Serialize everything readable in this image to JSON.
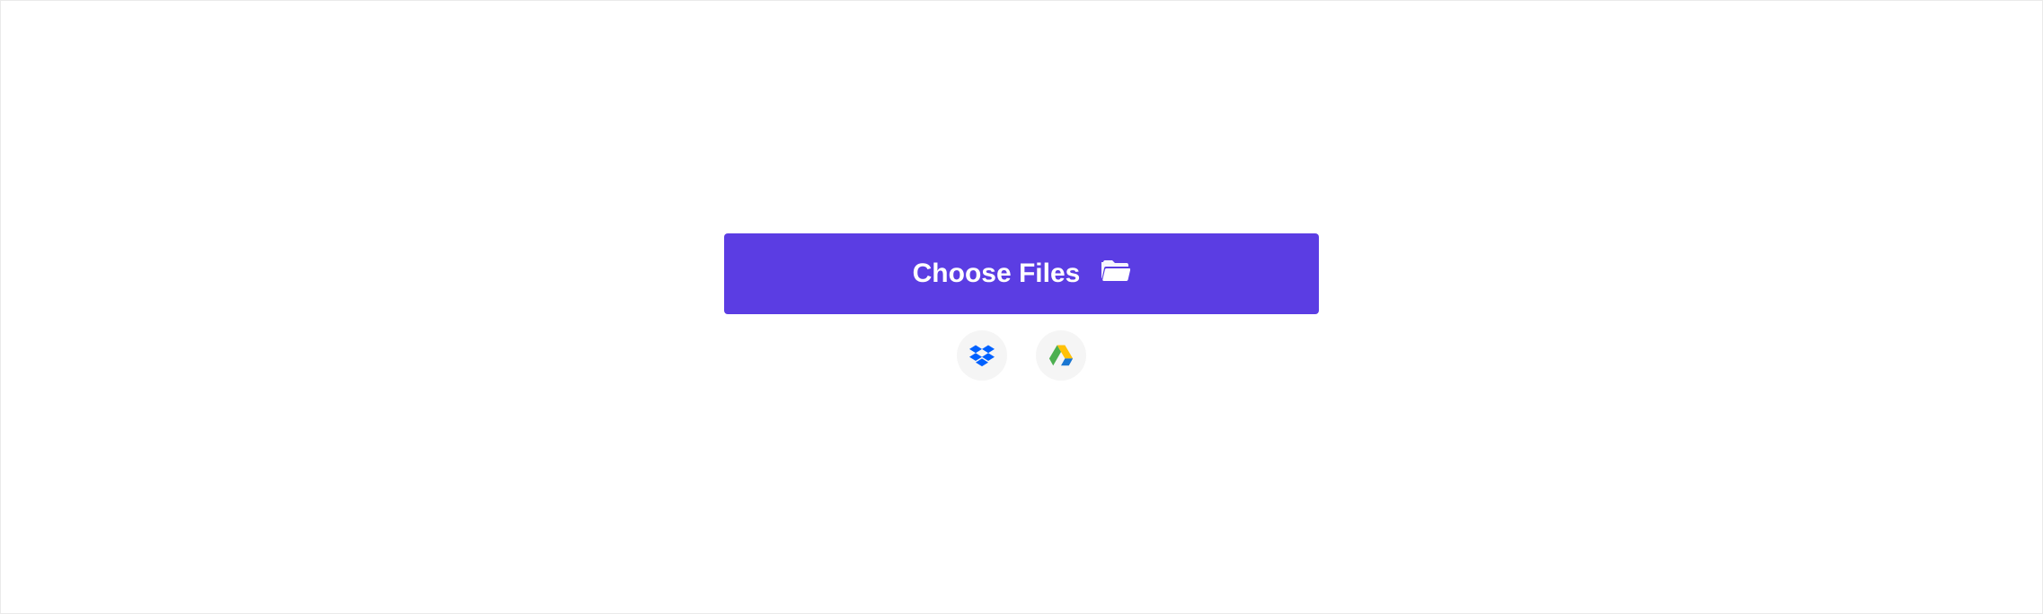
{
  "upload": {
    "choose_files_label": "Choose Files",
    "cloud_sources": [
      {
        "name": "dropbox"
      },
      {
        "name": "google-drive"
      }
    ]
  }
}
